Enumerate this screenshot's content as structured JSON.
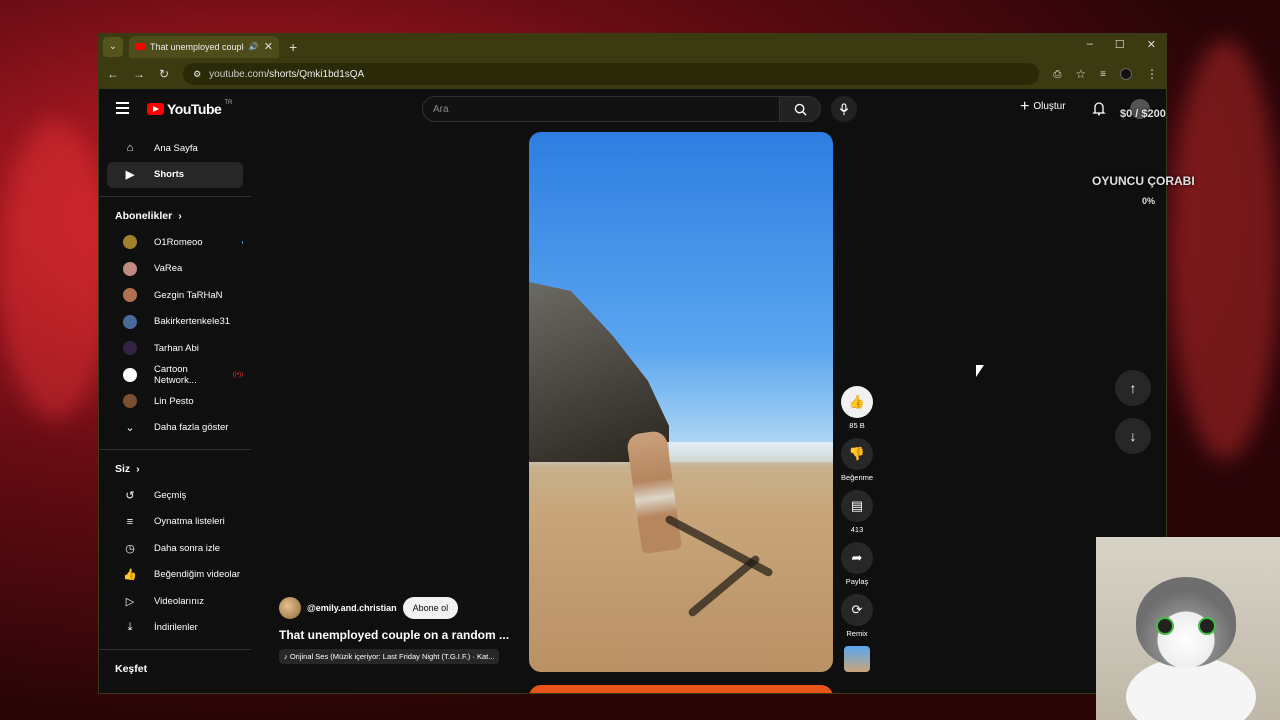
{
  "browser": {
    "tab_title": "That unemployed couple o",
    "url_prefix": "youtube.com",
    "url_path": "/shorts/Qmki1bd1sQA"
  },
  "header": {
    "logo": "YouTube",
    "region": "TR",
    "search_placeholder": "Ara",
    "create_label": "Oluştur"
  },
  "sidebar": {
    "main": [
      {
        "label": "Ana Sayfa",
        "icon": "home-icon"
      },
      {
        "label": "Shorts",
        "icon": "shorts-icon"
      }
    ],
    "subscriptions_title": "Abonelikler",
    "subscriptions": [
      {
        "label": "O1Romeoo",
        "color": "#a0802a"
      },
      {
        "label": "VaRea",
        "color": "#c08a80"
      },
      {
        "label": "Gezgin TaRHaN",
        "color": "#b07050"
      },
      {
        "label": "Bakirkertenkele31",
        "color": "#4a6a9a"
      },
      {
        "label": "Tarhan Abi",
        "color": "#332244"
      },
      {
        "label": "Cartoon Network...",
        "color": "#ffffff"
      },
      {
        "label": "Lin Pesto",
        "color": "#7a5030"
      }
    ],
    "show_more": "Daha fazla göster",
    "you_title": "Siz",
    "you": [
      {
        "label": "Geçmiş",
        "icon": "history-icon"
      },
      {
        "label": "Oynatma listeleri",
        "icon": "playlist-icon"
      },
      {
        "label": "Daha sonra izle",
        "icon": "clock-icon"
      },
      {
        "label": "Beğendiğim videolar",
        "icon": "like-icon"
      },
      {
        "label": "Videolarınız",
        "icon": "video-icon"
      },
      {
        "label": "İndirilenler",
        "icon": "download-icon"
      }
    ],
    "explore_title": "Keşfet"
  },
  "short": {
    "channel": "@emily.and.christian",
    "subscribe": "Abone ol",
    "title": "That unemployed couple on a random ...",
    "music": "Orijinal Ses (Müzik içeriyor: Last Friday Night (T.G.I.F.) · Kat..."
  },
  "actions": {
    "likes": "85 B",
    "dislike": "Beğenme",
    "comments": "413",
    "share": "Paylaş",
    "remix": "Remix"
  },
  "overlay": {
    "goal": "$0 / $200",
    "goal_title": "OYUNCU ÇORABI",
    "goal_percent": "0%"
  }
}
